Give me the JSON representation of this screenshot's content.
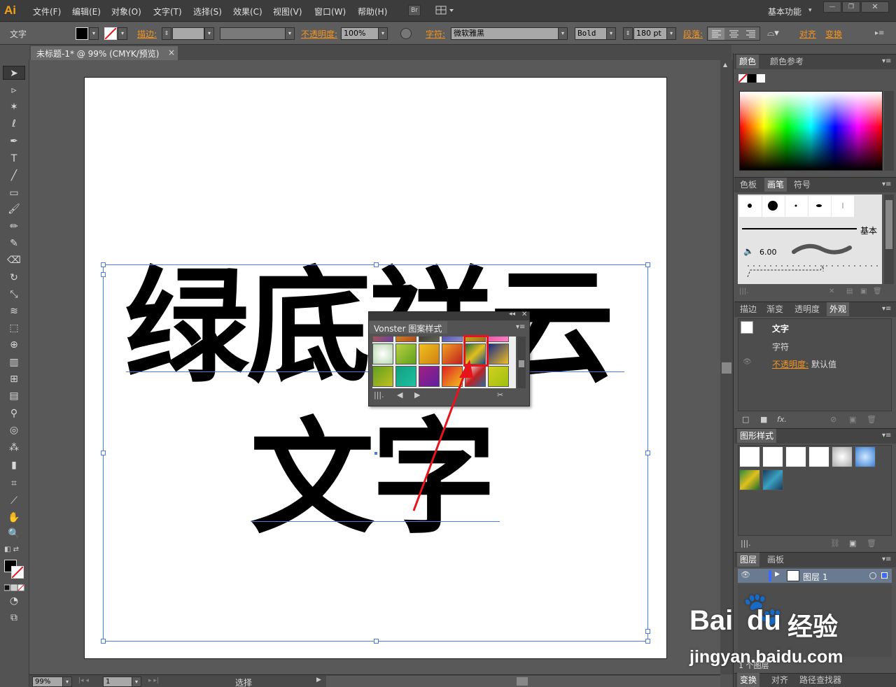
{
  "app": {
    "logo": "Ai",
    "workspace": "基本功能",
    "bridge": "Br"
  },
  "menu": [
    "文件(F)",
    "编辑(E)",
    "对象(O)",
    "文字(T)",
    "选择(S)",
    "效果(C)",
    "视图(V)",
    "窗口(W)",
    "帮助(H)"
  ],
  "control": {
    "type_label": "文字",
    "stroke_label": "描边:",
    "opacity_label": "不透明度:",
    "opacity_value": "100%",
    "char_label": "字符:",
    "font": "微软雅黑",
    "weight": "Bold",
    "size": "180 pt",
    "para_label": "段落:",
    "align_label": "对齐",
    "transform_label": "变换"
  },
  "document": {
    "tab_title": "未标题-1* @ 99% (CMYK/预览)",
    "close": "×"
  },
  "artwork": {
    "line1": "绿底祥云",
    "line2": "文字"
  },
  "pattern_panel": {
    "title": "Vonster 图案样式"
  },
  "panels": {
    "color_tabs": [
      "颜色",
      "颜色参考"
    ],
    "brush_tabs": [
      "色板",
      "画笔",
      "符号"
    ],
    "brush_basic": "基本",
    "brush_size": "6.00",
    "appearance_tabs": [
      "描边",
      "渐变",
      "透明度",
      "外观"
    ],
    "appearance_title": "文字",
    "appearance_char": "字符",
    "appearance_opacity_label": "不透明度:",
    "appearance_opacity_value": "默认值",
    "graphic_styles_title": "图形样式",
    "layers_tabs": [
      "图层",
      "画板"
    ],
    "layer_name": "图层 1",
    "layer_count": "1 个图层",
    "bottom_tabs": [
      "变换",
      "对齐",
      "路径查找器"
    ]
  },
  "status": {
    "zoom": "99%",
    "page": "1",
    "mode": "选择"
  },
  "watermark": {
    "brand": "Bai",
    "brand2": "du",
    "cn": "经验",
    "url": "jingyan.baidu.com"
  },
  "colors": {
    "accent_orange": "#f7941d",
    "selection_blue": "#4a7ee0",
    "annotation_red": "#e8141c"
  }
}
